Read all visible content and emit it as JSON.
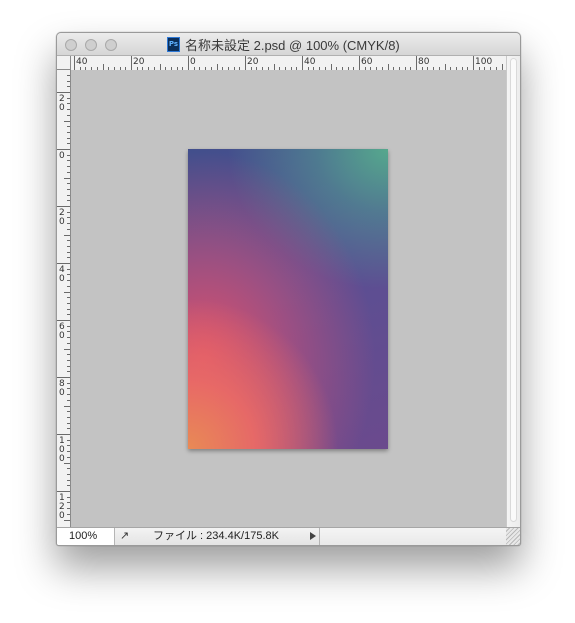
{
  "window": {
    "title": "名称未設定 2.psd @ 100% (CMYK/8)",
    "app_icon": "photoshop-document-icon",
    "app_icon_text": "Ps"
  },
  "ruler_top": {
    "labels": [
      "40",
      "20",
      "0",
      "20",
      "40",
      "60",
      "80",
      "100"
    ]
  },
  "ruler_left": {
    "labels": [
      "2\n0",
      "0",
      "2\n0",
      "4\n0",
      "6\n0",
      "8\n0",
      "1\n0\n0",
      "1\n2\n0"
    ]
  },
  "document": {
    "colors": [
      "#424f8c",
      "#56a88d",
      "#e4526a",
      "#e98a55",
      "#6b4a8d"
    ]
  },
  "status": {
    "zoom": "100%",
    "export_icon": "share-export-icon",
    "file_info": "ファイル : 234.4K/175.8K"
  }
}
